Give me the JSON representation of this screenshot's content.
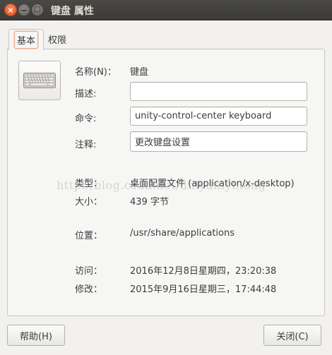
{
  "window": {
    "title": "键盘 属性",
    "close_glyph": "×",
    "minimize_glyph": "−",
    "maximize_glyph": "□"
  },
  "tabs": [
    {
      "label": "基本",
      "active": true
    },
    {
      "label": "权限",
      "active": false
    }
  ],
  "basic": {
    "name_label": "名称(N)：",
    "name_value": "键盘",
    "description_label": "描述:",
    "description_value": "",
    "command_label": "命令:",
    "command_value": "unity-control-center keyboard",
    "comment_label": "注释:",
    "comment_value": "更改键盘设置",
    "type_label": "类型：",
    "type_value": "桌面配置文件 (application/x-desktop)",
    "size_label": "大小：",
    "size_value": "439 字节",
    "location_label": "位置：",
    "location_value": "/usr/share/applications",
    "accessed_label": "访问：",
    "accessed_value": "2016年12月8日星期四，23:20:38",
    "modified_label": "修改：",
    "modified_value": "2015年9月16日星期三，17:44:48"
  },
  "watermark": "http://blog.csdn.net/dnlydnlyhlong",
  "buttons": {
    "help": "帮助(H)",
    "close": "关闭(C)"
  },
  "colors": {
    "close_button": "#e0531f",
    "titlebar": "#3b3a37",
    "tab_focus": "#f0a78a"
  }
}
